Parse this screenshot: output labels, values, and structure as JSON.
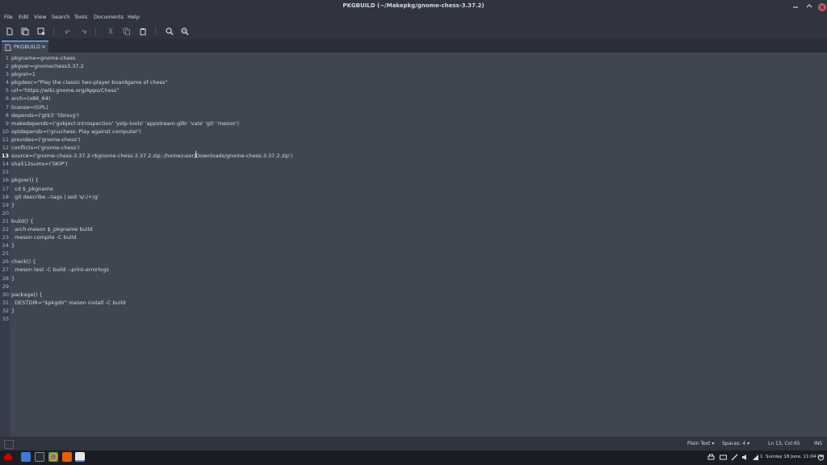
{
  "window": {
    "title": "PKGBUILD (~/Makepkg/gnome-chess-3.37.2)"
  },
  "menu": [
    "File",
    "Edit",
    "View",
    "Search",
    "Tools",
    "Documents",
    "Help"
  ],
  "tab": {
    "label": "PKGBUILD",
    "close": "×"
  },
  "editor": {
    "current_line": 13,
    "lines": [
      "pkgname=gnome-chess",
      "pkgver=gnomechess3.37.2",
      "pkgrel=1",
      "pkgdesc=\"Play the classic two-player boardgame of chess\"",
      "url=\"https://wiki.gnome.org/Apps/Chess\"",
      "arch=(x86_64)",
      "license=(GPL)",
      "depends=('gtk3' 'librsvg')",
      "makedepends=('gobject-introspection' 'yelp-tools' 'appstream-glib' 'vala' 'git' 'meson')",
      "optdepends=('gnuchess: Play against computer')",
      "provides=('gnome-chess')",
      "conflicts=('gnome-chess')",
      "source=('gnome-chess-3.37.2-r$gnome-chess-3.37.2.zip::/home/user/Downloads/gnome-chess-3.37.2.zip')",
      "sha512sums=('SKIP')",
      "",
      "pkgver() {",
      "  cd $_pkgname",
      "  git describe --tags | sed 's/-/+/g'",
      "}",
      "",
      "build() {",
      "  arch-meson $_pkgname build",
      "  meson compile -C build",
      "}",
      "",
      "check() {",
      "  meson test -C build --print-errorlogs",
      "}",
      "",
      "package() {",
      "  DESTDIR=\"$pkgdir\" meson install -C build",
      "}",
      ""
    ]
  },
  "status": {
    "language": "Plain Text ▾",
    "spaces": "Spaces: 4 ▾",
    "position": "Ln 13, Col 65",
    "mode": "INS"
  },
  "taskbar": {
    "clock": "Sunday 18 June, 11:04 PM",
    "workspace": "1"
  },
  "colors": {
    "accent": "#5294e2",
    "close": "#cc575d",
    "editor_bg": "#404552"
  }
}
